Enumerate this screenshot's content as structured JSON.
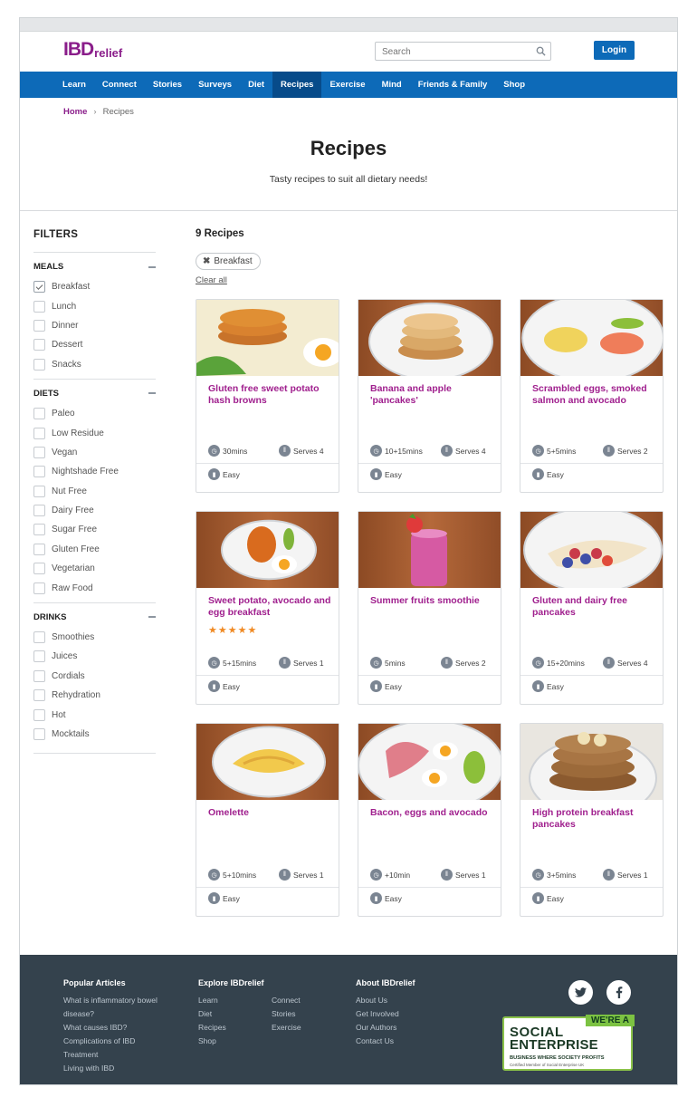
{
  "header": {
    "logo_big": "IBD",
    "logo_small": "relief",
    "search_placeholder": "Search",
    "login_label": "Login"
  },
  "nav": [
    "Learn",
    "Connect",
    "Stories",
    "Surveys",
    "Diet",
    "Recipes",
    "Exercise",
    "Mind",
    "Friends & Family",
    "Shop"
  ],
  "nav_active": "Recipes",
  "breadcrumb": {
    "home": "Home",
    "sep": "›",
    "current": "Recipes"
  },
  "hero": {
    "title": "Recipes",
    "subtitle": "Tasty recipes to suit all dietary needs!"
  },
  "filters": {
    "title": "FILTERS",
    "sections": [
      {
        "name": "MEALS",
        "items": [
          {
            "label": "Breakfast",
            "checked": true
          },
          {
            "label": "Lunch",
            "checked": false
          },
          {
            "label": "Dinner",
            "checked": false
          },
          {
            "label": "Dessert",
            "checked": false
          },
          {
            "label": "Snacks",
            "checked": false
          }
        ]
      },
      {
        "name": "DIETS",
        "items": [
          {
            "label": "Paleo",
            "checked": false
          },
          {
            "label": "Low Residue",
            "checked": false
          },
          {
            "label": "Vegan",
            "checked": false
          },
          {
            "label": "Nightshade Free",
            "checked": false
          },
          {
            "label": "Nut Free",
            "checked": false
          },
          {
            "label": "Dairy Free",
            "checked": false
          },
          {
            "label": "Sugar Free",
            "checked": false
          },
          {
            "label": "Gluten Free",
            "checked": false
          },
          {
            "label": "Vegetarian",
            "checked": false
          },
          {
            "label": "Raw Food",
            "checked": false
          }
        ]
      },
      {
        "name": "DRINKS",
        "items": [
          {
            "label": "Smoothies",
            "checked": false
          },
          {
            "label": "Juices",
            "checked": false
          },
          {
            "label": "Cordials",
            "checked": false
          },
          {
            "label": "Rehydration",
            "checked": false
          },
          {
            "label": "Hot",
            "checked": false
          },
          {
            "label": "Mocktails",
            "checked": false
          }
        ]
      }
    ]
  },
  "results": {
    "count_label": "9 Recipes",
    "active_filter": "Breakfast",
    "clear_label": "Clear all"
  },
  "recipes": [
    {
      "title": "Gluten free sweet potato hash browns",
      "time": "30mins",
      "serves": "Serves 4",
      "difficulty": "Easy",
      "rating": 0,
      "image": "hash-browns",
      "accent": "#c8732a"
    },
    {
      "title": "Banana and apple 'pancakes'",
      "time": "10+15mins",
      "serves": "Serves 4",
      "difficulty": "Easy",
      "rating": 0,
      "image": "pancakes",
      "accent": "#d9a867"
    },
    {
      "title": "Scrambled eggs, smoked salmon and avocado",
      "time": "5+5mins",
      "serves": "Serves 2",
      "difficulty": "Easy",
      "rating": 0,
      "image": "eggs-salmon",
      "accent": "#f0d35c"
    },
    {
      "title": "Sweet potato, avocado and egg breakfast",
      "time": "5+15mins",
      "serves": "Serves 1",
      "difficulty": "Easy",
      "rating": 5,
      "image": "sweet-potato-egg",
      "accent": "#d96b1e"
    },
    {
      "title": "Summer fruits smoothie",
      "time": "5mins",
      "serves": "Serves 2",
      "difficulty": "Easy",
      "rating": 0,
      "image": "smoothie",
      "accent": "#d65aa3"
    },
    {
      "title": "Gluten and dairy free pancakes",
      "time": "15+20mins",
      "serves": "Serves 4",
      "difficulty": "Easy",
      "rating": 0,
      "image": "berry-pancakes",
      "accent": "#c93b4a"
    },
    {
      "title": "Omelette",
      "time": "5+10mins",
      "serves": "Serves 1",
      "difficulty": "Easy",
      "rating": 0,
      "image": "omelette",
      "accent": "#f2c94c"
    },
    {
      "title": "Bacon, eggs and avocado",
      "time": "+10min",
      "serves": "Serves 1",
      "difficulty": "Easy",
      "rating": 0,
      "image": "bacon-eggs",
      "accent": "#e07e8a"
    },
    {
      "title": "High protein breakfast pancakes",
      "time": "3+5mins",
      "serves": "Serves 1",
      "difficulty": "Easy",
      "rating": 0,
      "image": "protein-pancakes",
      "accent": "#9c6a3a"
    }
  ],
  "footer": {
    "popular": {
      "title": "Popular Articles",
      "links": [
        "What is inflammatory bowel disease?",
        "What causes IBD?",
        "Complications of IBD",
        "Treatment",
        "Living with IBD"
      ]
    },
    "explore": {
      "title": "Explore IBDrelief",
      "col1": [
        "Learn",
        "Diet",
        "Recipes",
        "Shop"
      ],
      "col2": [
        "Connect",
        "Stories",
        "Exercise"
      ]
    },
    "about": {
      "title": "About IBDrelief",
      "links": [
        "About Us",
        "Get Involved",
        "Our Authors",
        "Contact Us"
      ]
    },
    "social": [
      {
        "icon": "twitter-icon",
        "glyph": "t"
      },
      {
        "icon": "facebook-icon",
        "glyph": "f"
      }
    ],
    "badge": {
      "tag": "WE'RE A",
      "line1": "SOCIAL",
      "line2": "ENTERPRISE",
      "line3": "BUSINESS WHERE SOCIETY PROFITS",
      "line4": "Certified Member of Social Enterprise UK"
    }
  },
  "colors": {
    "brand_purple": "#8a1d8a",
    "nav_blue": "#0d6ab8",
    "nav_active": "#074b8a",
    "footer_bg": "#34424d",
    "title_magenta": "#a0208e"
  }
}
